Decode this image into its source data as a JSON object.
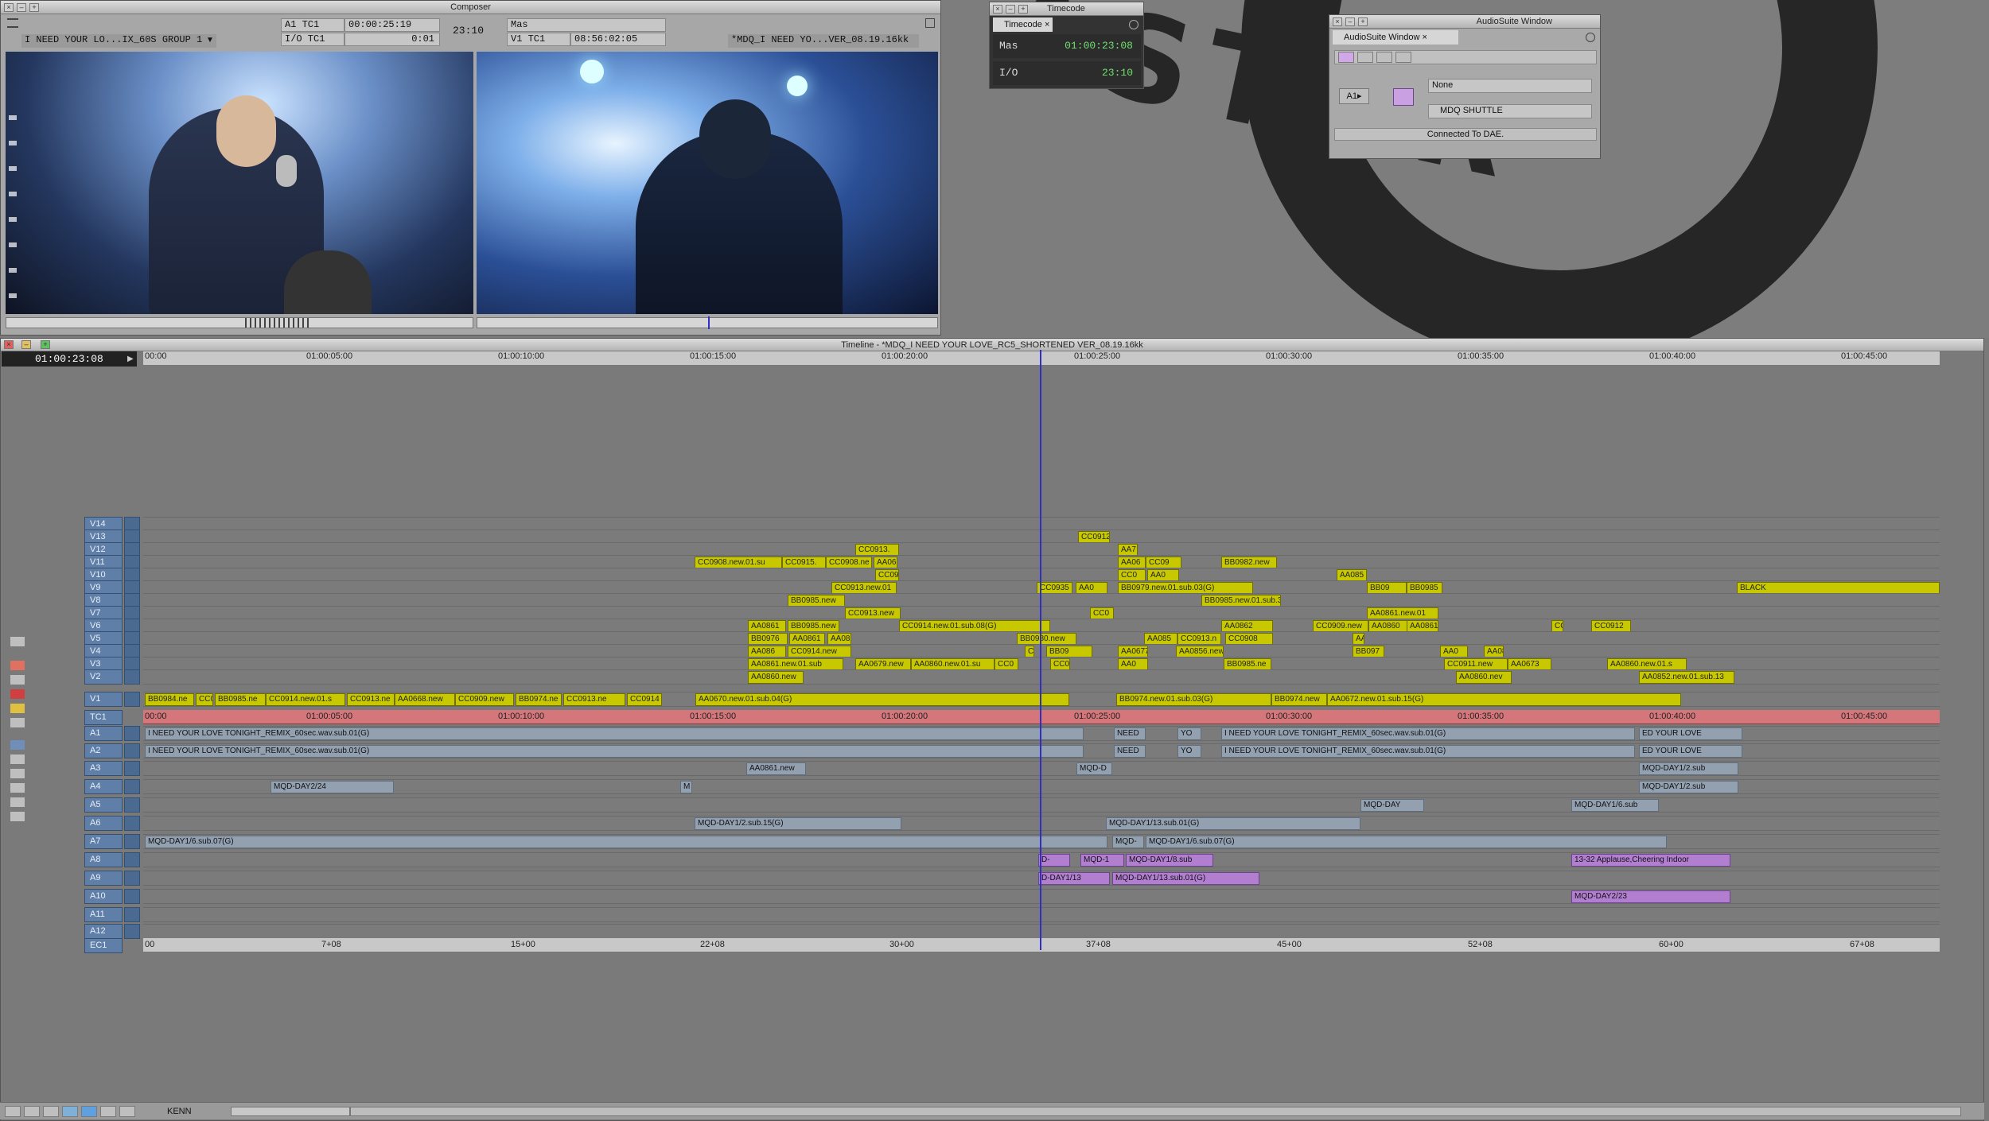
{
  "composer": {
    "title": "Composer",
    "left_seq": "I NEED YOUR LO...IX_60S GROUP 1",
    "a1tc_label": "A1 TC1",
    "a1tc_value": "00:00:25:19",
    "io_label": "I/O TC1",
    "io_value": "0:01",
    "center_value": "23:10",
    "mas_label": "Mas",
    "v1tc_label": "V1 TC1",
    "v1tc_value": "08:56:02:05",
    "right_seq": "*MDQ_I NEED YO...VER_08.19.16kk"
  },
  "timecode_window": {
    "title": "Timecode",
    "tab": "Timecode",
    "row1_label": "Mas",
    "row1_value": "01:00:23:08",
    "row2_label": "I/O",
    "row2_value": "23:10"
  },
  "audiosuite": {
    "title": "AudioSuite Window",
    "tab": "AudioSuite Window",
    "track_btn": "A1",
    "plugin": "None",
    "device": "MDQ SHUTTLE",
    "status": "Connected To DAE."
  },
  "timeline": {
    "title": "Timeline - *MDQ_I NEED YOUR LOVE_RC5_SHORTENED VER_08.19.16kk",
    "current_tc": "01:00:23:08",
    "ruler_ticks": [
      "00:00",
      "01:00:05:00",
      "01:00:10:00",
      "01:00:15:00",
      "01:00:20:00",
      "01:00:25:00",
      "01:00:30:00",
      "01:00:35:00",
      "01:00:40:00",
      "01:00:45:00"
    ],
    "ec_ticks": [
      "00",
      "7+08",
      "15+00",
      "22+08",
      "30+00",
      "37+08",
      "45+00",
      "52+08",
      "60+00",
      "67+08"
    ],
    "tracks": [
      {
        "name": "V14",
        "clips": []
      },
      {
        "name": "V13",
        "clips": [
          {
            "label": "CC0912"
          }
        ]
      },
      {
        "name": "V12",
        "clips": [
          {
            "label": "CC0913."
          },
          {
            "label": "AA7"
          }
        ]
      },
      {
        "name": "V11",
        "clips": [
          {
            "label": "CC0908.new.01.su"
          },
          {
            "label": "CC0915."
          },
          {
            "label": "CC0908.ne"
          },
          {
            "label": "AA06"
          },
          {
            "label": "AA06"
          },
          {
            "label": "CC09"
          },
          {
            "label": "BB0982.new"
          }
        ]
      },
      {
        "name": "V10",
        "clips": [
          {
            "label": "CC09"
          },
          {
            "label": "CC0"
          },
          {
            "label": "AA0"
          },
          {
            "label": "AA085"
          }
        ]
      },
      {
        "name": "V9",
        "clips": [
          {
            "label": "CC0913.new.01"
          },
          {
            "label": "CC0935"
          },
          {
            "label": "AA0"
          },
          {
            "label": "BB0979.new.01.sub.03(G)"
          },
          {
            "label": "BB09"
          },
          {
            "label": "BB0985"
          },
          {
            "label": "BLACK"
          }
        ]
      },
      {
        "name": "V8",
        "clips": [
          {
            "label": "BB0985.new"
          },
          {
            "label": "BB0985.new.01.sub.36(G)"
          }
        ]
      },
      {
        "name": "V7",
        "clips": [
          {
            "label": "CC0913.new"
          },
          {
            "label": "CC0"
          },
          {
            "label": "AA0861.new.01"
          }
        ]
      },
      {
        "name": "V6",
        "clips": [
          {
            "label": "AA0861"
          },
          {
            "label": "BB0985.new"
          },
          {
            "label": "CC0914.new.01.sub.08(G)"
          },
          {
            "label": "AA0862"
          },
          {
            "label": "CC0909.new"
          },
          {
            "label": "AA0860"
          },
          {
            "label": "AA0861"
          },
          {
            "label": "CC"
          },
          {
            "label": "CC0912"
          }
        ]
      },
      {
        "name": "V5",
        "clips": [
          {
            "label": "BB0976"
          },
          {
            "label": "AA0861"
          },
          {
            "label": "AA08"
          },
          {
            "label": "BB0980.new"
          },
          {
            "label": "AA085"
          },
          {
            "label": "CC0913.n"
          },
          {
            "label": "CC0908"
          },
          {
            "label": "AA0"
          }
        ]
      },
      {
        "name": "V4",
        "clips": [
          {
            "label": "AA086"
          },
          {
            "label": "CC0914.new"
          },
          {
            "label": "CC09"
          },
          {
            "label": "BB09"
          },
          {
            "label": "AA0677.ne"
          },
          {
            "label": "AA0856.new"
          },
          {
            "label": "BB097"
          },
          {
            "label": "AA0"
          },
          {
            "label": "AA0861"
          }
        ]
      },
      {
        "name": "V3",
        "clips": [
          {
            "label": "AA0861.new.01.sub"
          },
          {
            "label": "AA0679.new"
          },
          {
            "label": "AA0860.new.01.su"
          },
          {
            "label": "CC0"
          },
          {
            "label": "CC0"
          },
          {
            "label": "AA0"
          },
          {
            "label": "BB0985.ne"
          },
          {
            "label": "CC0911.new"
          },
          {
            "label": "AA0673"
          },
          {
            "label": "AA0860.new.01.s"
          }
        ]
      },
      {
        "name": "V2",
        "clips": [
          {
            "label": "AA0860.new"
          },
          {
            "label": "AA0860.nev"
          },
          {
            "label": "AA0852.new.01.sub.13"
          }
        ]
      },
      {
        "name": "V1",
        "clips": [
          {
            "label": "BB0984.ne"
          },
          {
            "label": "CC0"
          },
          {
            "label": "BB0985.ne"
          },
          {
            "label": "CC0914.new.01.s"
          },
          {
            "label": "CC0913.ne"
          },
          {
            "label": "AA0668.new"
          },
          {
            "label": "CC0909.new"
          },
          {
            "label": "BB0974.ne"
          },
          {
            "label": "CC0913.ne"
          },
          {
            "label": "CC0914"
          },
          {
            "label": "AA0670.new.01.sub.04(G)"
          },
          {
            "label": "BB0974.new.01.sub.03(G)"
          },
          {
            "label": "BB0974.new"
          },
          {
            "label": "AA0672.new.01.sub.15(G)"
          }
        ]
      },
      {
        "name": "TC1",
        "clips": []
      },
      {
        "name": "A1",
        "clips": [
          {
            "label": "I NEED YOUR LOVE TONIGHT_REMIX_60sec.wav.sub.01(G)"
          },
          {
            "label": "NEED"
          },
          {
            "label": "YO"
          },
          {
            "label": "I NEED YOUR LOVE TONIGHT_REMIX_60sec.wav.sub.01(G)"
          },
          {
            "label": "ED YOUR LOVE"
          }
        ]
      },
      {
        "name": "A2",
        "clips": [
          {
            "label": "I NEED YOUR LOVE TONIGHT_REMIX_60sec.wav.sub.01(G)"
          },
          {
            "label": "NEED"
          },
          {
            "label": "YO"
          },
          {
            "label": "I NEED YOUR LOVE TONIGHT_REMIX_60sec.wav.sub.01(G)"
          },
          {
            "label": "ED YOUR LOVE"
          }
        ]
      },
      {
        "name": "A3",
        "clips": [
          {
            "label": "AA0861.new"
          },
          {
            "label": "MQD-D"
          },
          {
            "label": "MQD-DAY1/2.sub"
          }
        ]
      },
      {
        "name": "A4",
        "clips": [
          {
            "label": "MQD-DAY2/24"
          },
          {
            "label": "M"
          },
          {
            "label": "MQD-DAY1/2.sub"
          }
        ]
      },
      {
        "name": "A5",
        "clips": [
          {
            "label": "MQD-DAY"
          },
          {
            "label": "MQD-DAY1/6.sub"
          }
        ]
      },
      {
        "name": "A6",
        "clips": [
          {
            "label": "MQD-DAY1/2.sub.15(G)"
          },
          {
            "label": "MQD-DAY1/13.sub.01(G)"
          }
        ]
      },
      {
        "name": "A7",
        "clips": [
          {
            "label": "MQD-DAY1/6.sub.07(G)"
          },
          {
            "label": "MQD-"
          },
          {
            "label": "MQD-DAY1/6.sub.07(G)"
          }
        ]
      },
      {
        "name": "A8",
        "clips": [
          {
            "label": "D-"
          },
          {
            "label": "MQD-1"
          },
          {
            "label": "MQD-DAY1/8.sub"
          },
          {
            "label": "13-32 Applause,Cheering Indoor"
          }
        ]
      },
      {
        "name": "A9",
        "clips": [
          {
            "label": "D-DAY1/13"
          },
          {
            "label": "MQD-DAY1/13.sub.01(G)"
          }
        ]
      },
      {
        "name": "A10",
        "clips": [
          {
            "label": "MQD-DAY2/23"
          }
        ]
      },
      {
        "name": "A11",
        "clips": []
      },
      {
        "name": "A12",
        "clips": []
      },
      {
        "name": "EC1",
        "clips": []
      }
    ]
  },
  "bottom": {
    "user": "KENN"
  }
}
